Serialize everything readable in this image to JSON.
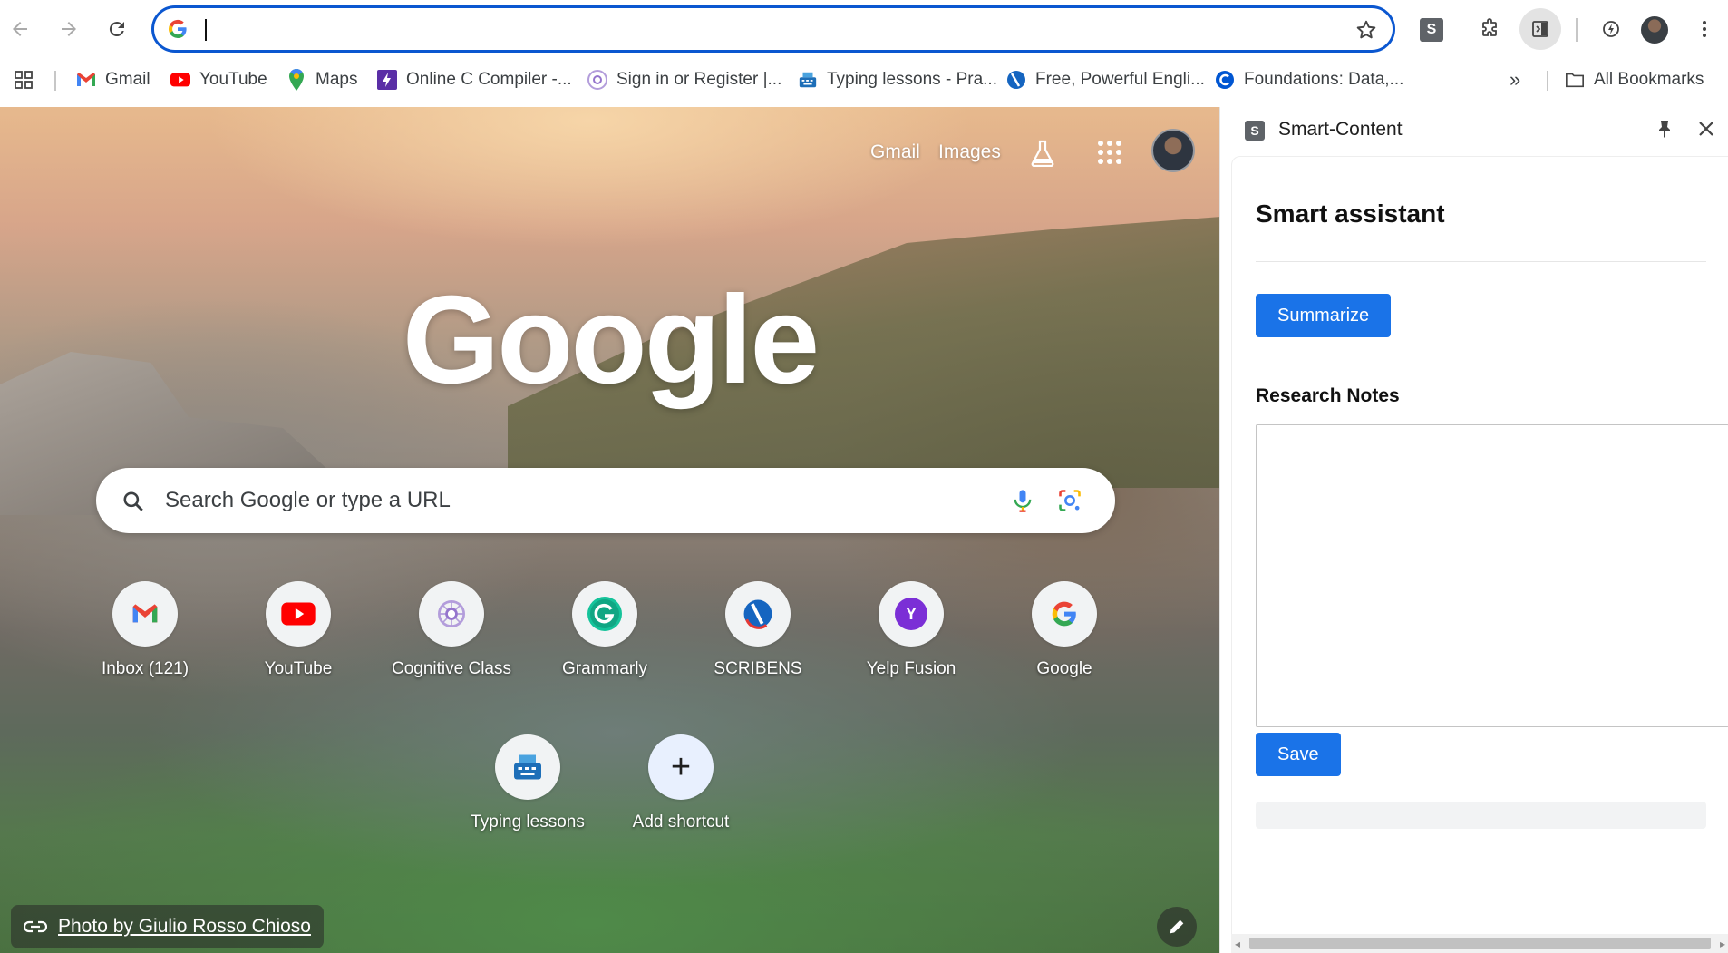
{
  "toolbar": {
    "back_icon": "arrow-back-icon",
    "forward_icon": "arrow-forward-icon",
    "reload_icon": "reload-icon",
    "omnibox_value": "",
    "star_icon": "star-outline-icon",
    "extension_s_label": "S",
    "accent_color": "#0b57d0"
  },
  "bookmarks": {
    "items": [
      {
        "label": "Gmail",
        "icon": "gmail-icon"
      },
      {
        "label": "YouTube",
        "icon": "youtube-icon"
      },
      {
        "label": "Maps",
        "icon": "maps-pin-icon"
      },
      {
        "label": "Online C Compiler -...",
        "icon": "lightning-icon"
      },
      {
        "label": "Sign in or Register |...",
        "icon": "cognitive-icon"
      },
      {
        "label": "Typing lessons - Pra...",
        "icon": "keyboard-icon"
      },
      {
        "label": "Free, Powerful Engli...",
        "icon": "scribens-icon"
      },
      {
        "label": "Foundations: Data,...",
        "icon": "coursera-icon"
      }
    ],
    "more_label": "»",
    "all_bookmarks_label": "All Bookmarks"
  },
  "ntp": {
    "top_links": {
      "gmail": "Gmail",
      "images": "Images"
    },
    "logo_text": "Google",
    "search_placeholder": "Search Google or type a URL",
    "shortcuts": [
      {
        "label": "Inbox (121)",
        "icon": "gmail-icon"
      },
      {
        "label": "YouTube",
        "icon": "youtube-icon"
      },
      {
        "label": "Cognitive Class",
        "icon": "cognitive-icon"
      },
      {
        "label": "Grammarly",
        "icon": "grammarly-icon"
      },
      {
        "label": "SCRIBENS",
        "icon": "scribens-icon"
      },
      {
        "label": "Yelp Fusion",
        "icon": "yelp-y-icon",
        "letter": "Y"
      },
      {
        "label": "Google",
        "icon": "google-g-icon"
      },
      {
        "label": "Typing lessons",
        "icon": "keyboard-icon"
      },
      {
        "label": "Add shortcut",
        "icon": "plus-icon",
        "glyph": "+"
      }
    ],
    "photo_credit": "Photo by Giulio Rosso Chioso"
  },
  "side_panel": {
    "logo_letter": "S",
    "title": "Smart-Content",
    "heading": "Smart assistant",
    "summarize_label": "Summarize",
    "notes_heading": "Research Notes",
    "notes_value": "",
    "save_label": "Save",
    "button_color": "#1a73e8"
  }
}
